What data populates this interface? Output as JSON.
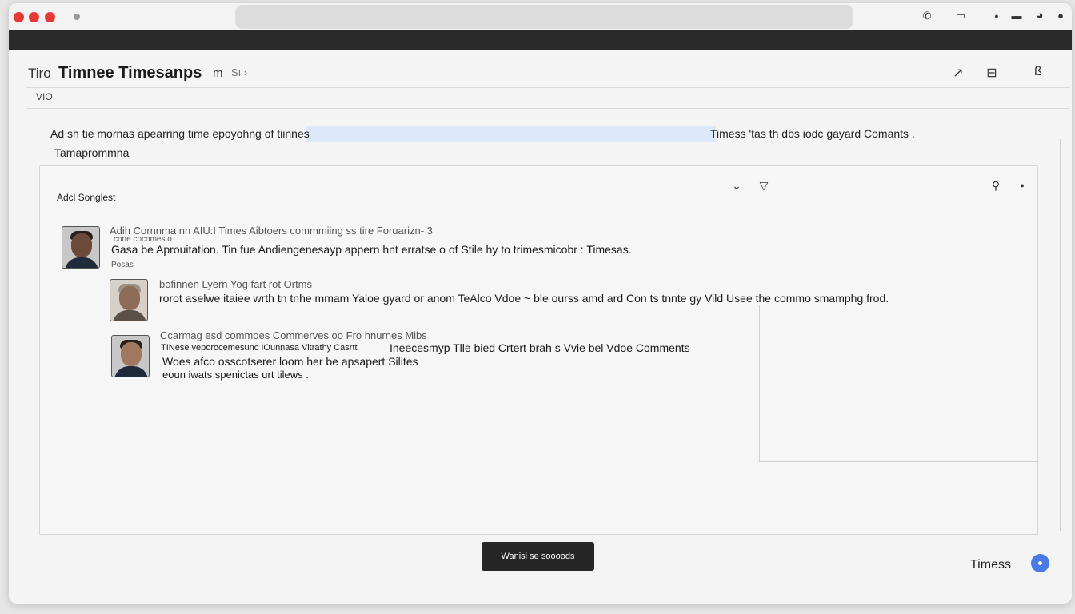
{
  "window": {
    "title_prefix": "Tiro",
    "title_main": "Timnee Timesanps",
    "title_suffix": "m",
    "title_meta": "Sı ›",
    "sub_label": "VIO"
  },
  "toolbar_icons": [
    "phone-icon",
    "window-icon",
    "dot-icon",
    "minimize-icon",
    "profile-icon"
  ],
  "header_icons": [
    "edit-icon",
    "share-icon",
    "bookmark-icon"
  ],
  "description": {
    "line_left": "Ad sh tie mornas apearring time epoyohng of",
    "line_highlighted": "tiinnes",
    "line_right": "Timess 'tas th dbs iodc gayard Comants .",
    "sub": "Tamaprommna"
  },
  "panel": {
    "title": "Adcl Songlest",
    "icons": [
      "collapse-icon",
      "filter-icon",
      "pin-icon",
      "more-icon"
    ]
  },
  "comments": [
    {
      "meta": "Adih Cornnma nn AIU:I Times Aibtoers commmiing ss tire Foruarizn- 3",
      "small": "cone cocomes o",
      "text": "Gasa be Aprouitation. Tin fue Andiengenesayp appern hnt erratse o of Stile hy to trimesmicobr : Timesas.",
      "small2": "Posas"
    },
    {
      "meta": "bofinnen Lyern Yog fart rot Ortms",
      "text": "rorot aselwe itaiee wrth tn tnhe mmam Yaloe gyard or anom TeAlco Vdoe ~  ble ourss amd ard Con ts tnnte gy Vild Usee  the commo smamphg frod."
    },
    {
      "meta": "Ccarmag esd commoes Commerves oo Fro hnurnes Mibs",
      "text1": "TINese veporocemesunc IOunnasa Vitrathy Casrtt",
      "text1b": "Ineecesmyp Tlle bied Crtert brah s Vvie bel Vdoe Comments",
      "text2": "Woes afco osscotserer loom her be apsapert Silites",
      "text3": "eoun iwats spenictas urt tilews ."
    }
  ],
  "footer": {
    "primary_button": "Wanisi se soooods",
    "label": "Timess"
  },
  "colors": {
    "accent": "#4a7ae8",
    "traffic_light": "#e53935",
    "highlight": "#dde8fb",
    "dark_bar": "#2a2a2a"
  }
}
